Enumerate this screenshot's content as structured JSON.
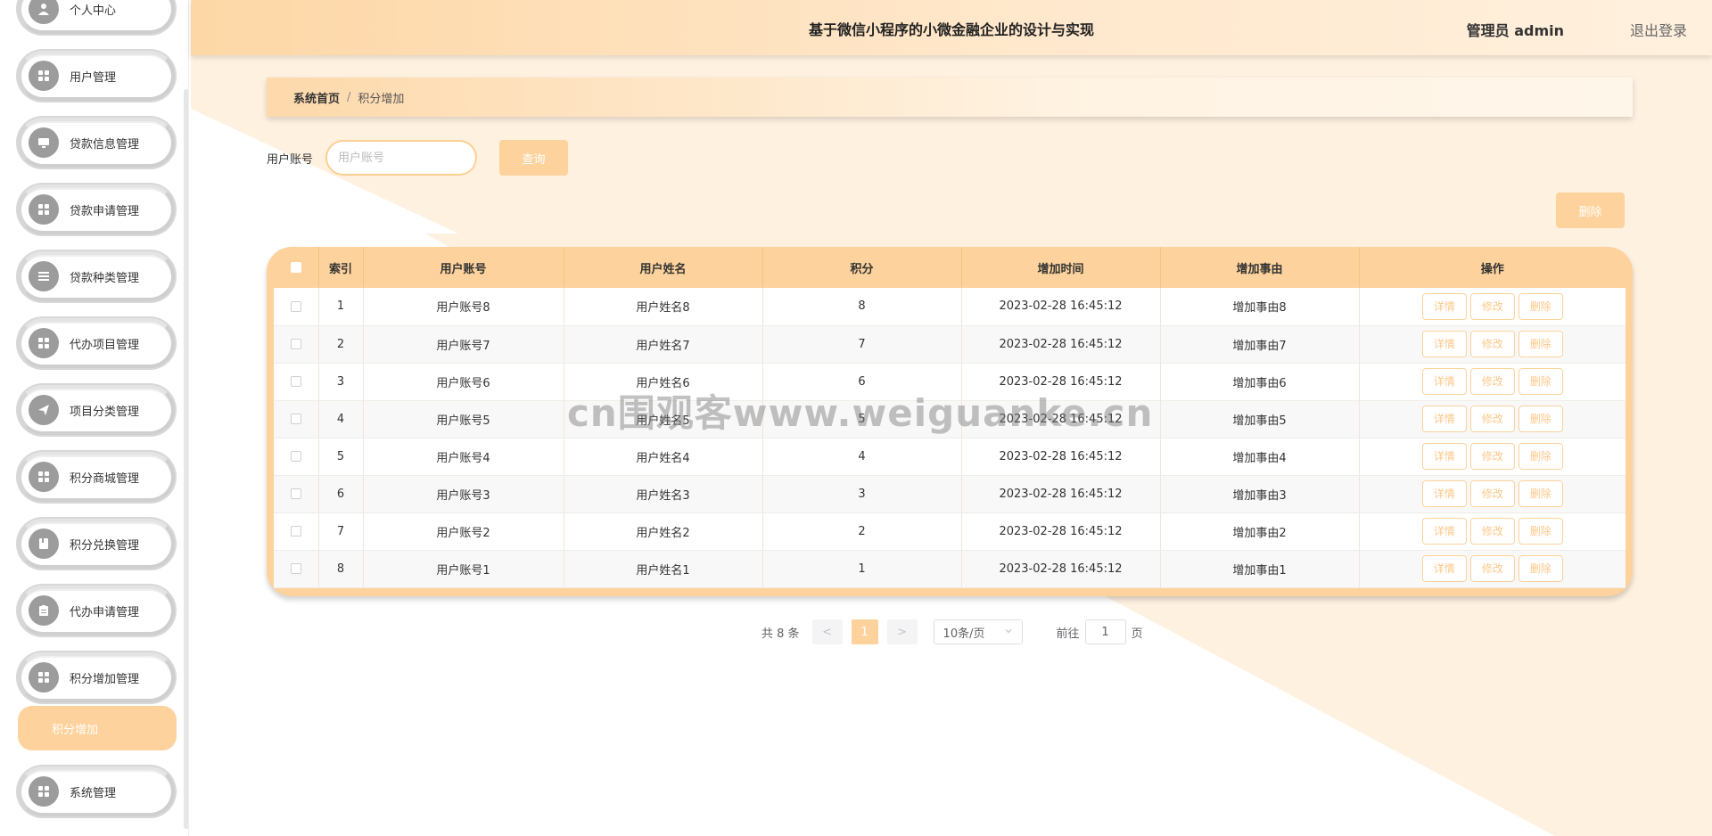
{
  "header": {
    "title": "基于微信小程序的小微金融企业的设计与实现",
    "user_label": "管理员 admin",
    "logout_label": "退出登录"
  },
  "sidebar": {
    "items": [
      {
        "label": "个人中心",
        "icon": "user-icon"
      },
      {
        "label": "用户管理",
        "icon": "grid-icon"
      },
      {
        "label": "贷款信息管理",
        "icon": "monitor-icon"
      },
      {
        "label": "贷款申请管理",
        "icon": "grid-icon"
      },
      {
        "label": "贷款种类管理",
        "icon": "list-icon"
      },
      {
        "label": "代办项目管理",
        "icon": "grid-icon"
      },
      {
        "label": "项目分类管理",
        "icon": "send-icon"
      },
      {
        "label": "积分商城管理",
        "icon": "grid-icon"
      },
      {
        "label": "积分兑换管理",
        "icon": "book-icon"
      },
      {
        "label": "代办申请管理",
        "icon": "clipboard-icon"
      },
      {
        "label": "积分增加管理",
        "icon": "grid-icon"
      },
      {
        "label": "系统管理",
        "icon": "grid-icon"
      }
    ],
    "active_submenu": "积分增加"
  },
  "breadcrumb": {
    "home": "系统首页",
    "separator": "/",
    "current": "积分增加"
  },
  "search": {
    "label": "用户账号",
    "placeholder": "用户账号",
    "button": "查询"
  },
  "actions": {
    "delete_button": "删除"
  },
  "table": {
    "columns": [
      "索引",
      "用户账号",
      "用户姓名",
      "积分",
      "增加时间",
      "增加事由",
      "操作"
    ],
    "rows": [
      {
        "index": "1",
        "account": "用户账号8",
        "name": "用户姓名8",
        "points": "8",
        "time": "2023-02-28 16:45:12",
        "reason": "增加事由8"
      },
      {
        "index": "2",
        "account": "用户账号7",
        "name": "用户姓名7",
        "points": "7",
        "time": "2023-02-28 16:45:12",
        "reason": "增加事由7"
      },
      {
        "index": "3",
        "account": "用户账号6",
        "name": "用户姓名6",
        "points": "6",
        "time": "2023-02-28 16:45:12",
        "reason": "增加事由6"
      },
      {
        "index": "4",
        "account": "用户账号5",
        "name": "用户姓名5",
        "points": "5",
        "time": "2023-02-28 16:45:12",
        "reason": "增加事由5"
      },
      {
        "index": "5",
        "account": "用户账号4",
        "name": "用户姓名4",
        "points": "4",
        "time": "2023-02-28 16:45:12",
        "reason": "增加事由4"
      },
      {
        "index": "6",
        "account": "用户账号3",
        "name": "用户姓名3",
        "points": "3",
        "time": "2023-02-28 16:45:12",
        "reason": "增加事由3"
      },
      {
        "index": "7",
        "account": "用户账号2",
        "name": "用户姓名2",
        "points": "2",
        "time": "2023-02-28 16:45:12",
        "reason": "增加事由2"
      },
      {
        "index": "8",
        "account": "用户账号1",
        "name": "用户姓名1",
        "points": "1",
        "time": "2023-02-28 16:45:12",
        "reason": "增加事由1"
      }
    ],
    "row_actions": {
      "detail": "详情",
      "edit": "修改",
      "delete": "删除"
    }
  },
  "pagination": {
    "total": "共 8 条",
    "prev": "<",
    "current_page": "1",
    "next": ">",
    "page_size": "10条/页",
    "goto_label": "前往",
    "goto_value": "1",
    "goto_unit": "页"
  },
  "watermark": "cn围观客www.weiguanke.cn",
  "colors": {
    "accent": "#fdd29c",
    "accent_text": "#fdc88a",
    "header_gradient_start": "#fdd7a6",
    "background_tint": "#fff1e0"
  }
}
